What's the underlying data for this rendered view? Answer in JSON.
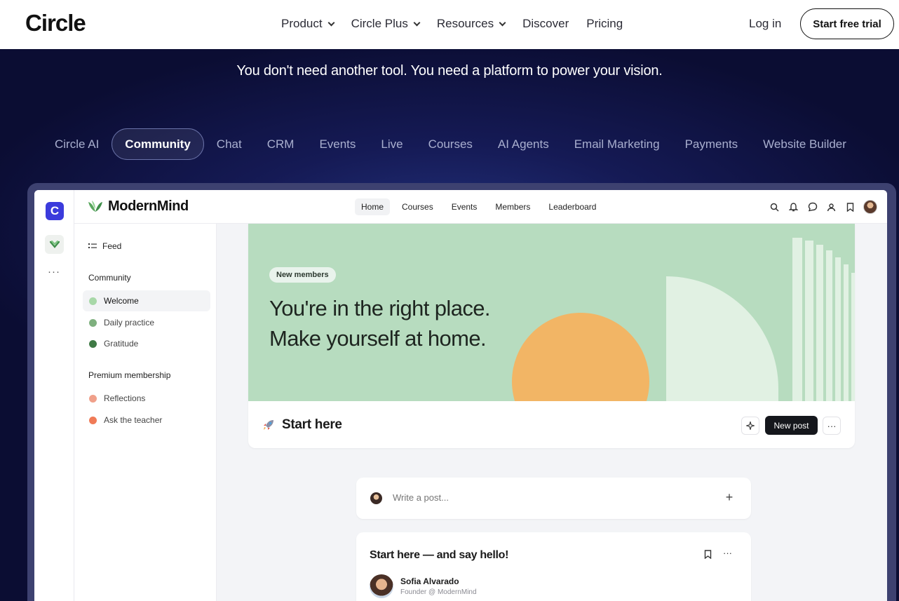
{
  "topnav": {
    "logo": "Circle",
    "links": [
      {
        "label": "Product",
        "dropdown": true
      },
      {
        "label": "Circle Plus",
        "dropdown": true
      },
      {
        "label": "Resources",
        "dropdown": true
      },
      {
        "label": "Discover",
        "dropdown": false
      },
      {
        "label": "Pricing",
        "dropdown": false
      }
    ],
    "login": "Log in",
    "cta": "Start free trial"
  },
  "hero": {
    "tagline": "You don't need another tool. You need a platform to power your vision.",
    "tabs": [
      "Circle AI",
      "Community",
      "Chat",
      "CRM",
      "Events",
      "Live",
      "Courses",
      "AI Agents",
      "Email Marketing",
      "Payments",
      "Website Builder"
    ],
    "active_tab": "Community"
  },
  "app": {
    "rail": {
      "logo_letter": "C",
      "more": "···"
    },
    "brand": "ModernMind",
    "nav": [
      "Home",
      "Courses",
      "Events",
      "Members",
      "Leaderboard"
    ],
    "active_nav": "Home",
    "header_icons": [
      "search-icon",
      "bell-icon",
      "chat-icon",
      "user-icon",
      "bookmark-icon"
    ],
    "sidebar": {
      "feed": "Feed",
      "sections": [
        {
          "heading": "Community",
          "items": [
            {
              "label": "Welcome",
              "color": "#a8d8a8"
            },
            {
              "label": "Daily practice",
              "color": "#7fb07f"
            },
            {
              "label": "Gratitude",
              "color": "#3f7a45"
            }
          ]
        },
        {
          "heading": "Premium membership",
          "items": [
            {
              "label": "Reflections",
              "color": "#f0a08a"
            },
            {
              "label": "Ask the teacher",
              "color": "#f07b57"
            }
          ]
        }
      ]
    },
    "banner": {
      "pill": "New members",
      "line1": "You're in the right place.",
      "line2": "Make yourself at home."
    },
    "start_here": {
      "title": "Start here",
      "new_post": "New post"
    },
    "compose": {
      "placeholder": "Write a post..."
    },
    "post": {
      "title": "Start here — and say hello!",
      "author": "Sofia Alvarado",
      "role": "Founder @ ModernMind"
    }
  },
  "colors": {
    "hero_bg": "#0b0d33",
    "banner_green": "#b7dcbf",
    "orange_circle": "#f2b565",
    "new_post_button": "#15171c",
    "rail_logo": "#3b3bdc"
  }
}
